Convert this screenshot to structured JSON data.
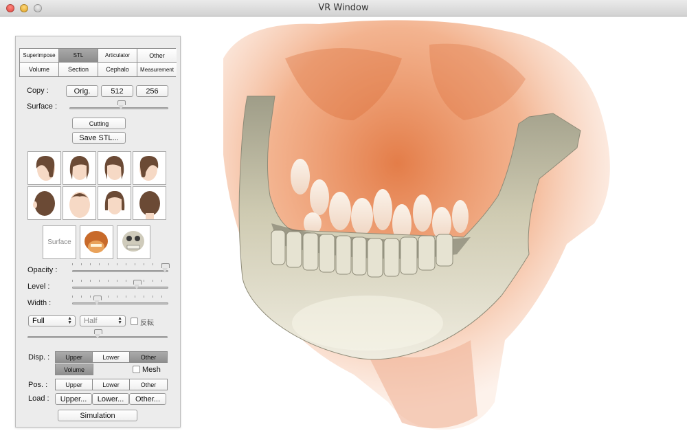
{
  "window": {
    "title": "VR Window"
  },
  "tabs": {
    "row1": [
      "Superimpose",
      "STL",
      "Articulator",
      "Other"
    ],
    "row2": [
      "Volume",
      "Section",
      "Cephalo",
      "Measurement"
    ],
    "selected": "STL"
  },
  "copy": {
    "label": "Copy :",
    "buttons": [
      "Orig.",
      "512",
      "256"
    ]
  },
  "surface": {
    "label": "Surface :",
    "value_fraction": 0.52
  },
  "cutting_label": "Cutting",
  "save_stl_label": "Save STL...",
  "view_modes": {
    "surface_label": "Surface"
  },
  "opacity": {
    "label": "Opacity :",
    "value_fraction": 1.0
  },
  "level": {
    "label": "Level :",
    "value_fraction": 0.67
  },
  "width": {
    "label": "Width :",
    "value_fraction": 0.26
  },
  "quality": {
    "full": "Full",
    "half": "Half",
    "invert_label": "反転"
  },
  "bottom_slider_fraction": 0.5,
  "disp": {
    "label": "Disp. :",
    "buttons": [
      "Upper",
      "Lower",
      "Other"
    ],
    "volume": "Volume",
    "mesh_label": "Mesh"
  },
  "pos": {
    "label": "Pos. :",
    "buttons": [
      "Upper",
      "Lower",
      "Other"
    ]
  },
  "load": {
    "label": "Load :",
    "buttons": [
      "Upper...",
      "Lower...",
      "Other..."
    ]
  },
  "simulation_label": "Simulation",
  "colors": {
    "selected_tab": "#9a9a9a",
    "volume_tissue": "#e88a55",
    "bone": "#d8d4bd"
  }
}
